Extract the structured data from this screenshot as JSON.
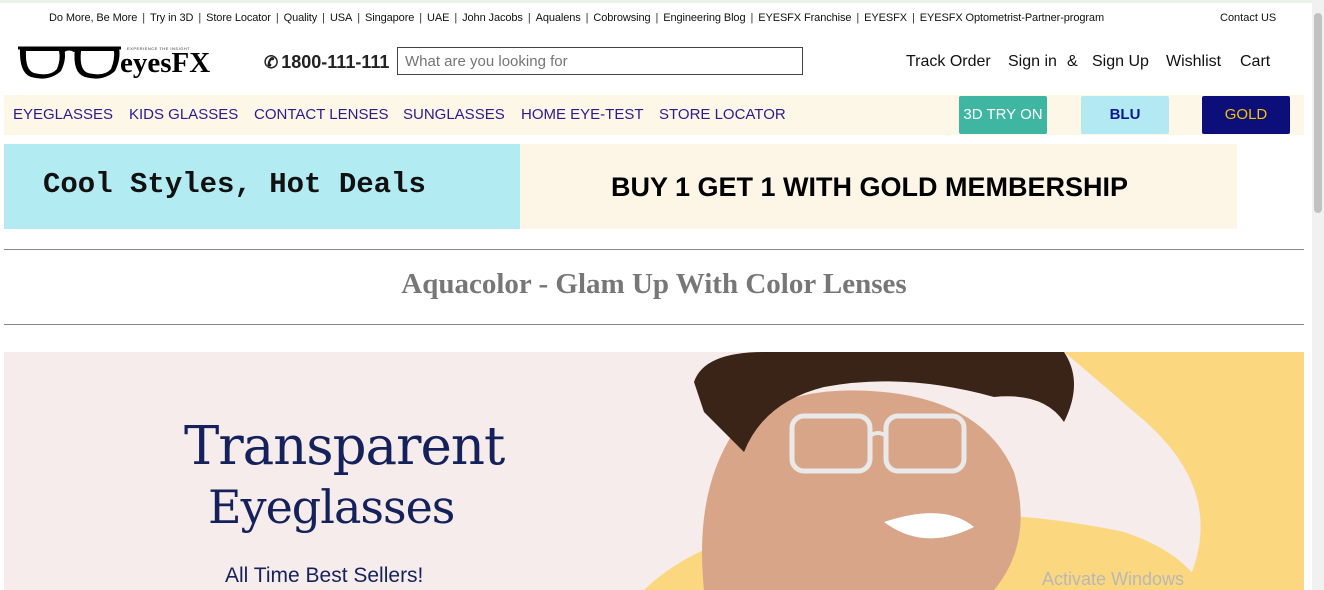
{
  "utility_links": [
    "Do More, Be More",
    "Try in 3D",
    "Store Locator",
    "Quality",
    "USA",
    "Singapore",
    "UAE",
    "John Jacobs",
    "Aqualens",
    "Cobrowsing",
    "Engineering Blog",
    "EYESFX Franchise",
    "EYESFX",
    "EYESFX Optometrist-Partner-program"
  ],
  "contact_label": "Contact US",
  "logo": {
    "text": "eyesFX",
    "tagline": "EXPERIENCE THE INSIGHT"
  },
  "phone": "1800-111-111",
  "search": {
    "placeholder": "What are you looking for"
  },
  "account": {
    "track_order": "Track Order",
    "sign_in": "Sign in",
    "amp": "&",
    "sign_up": "Sign Up",
    "wishlist": "Wishlist",
    "cart": "Cart"
  },
  "nav": [
    "EYEGLASSES",
    "KIDS GLASSES",
    "CONTACT LENSES",
    "SUNGLASSES",
    "HOME EYE-TEST",
    "STORE LOCATOR"
  ],
  "buttons": {
    "try_3d": "3D TRY ON",
    "blu": "BLU",
    "gold": "GOLD"
  },
  "promo": {
    "left": "Cool Styles, Hot Deals",
    "right": "BUY 1 GET 1 WITH GOLD MEMBERSHIP"
  },
  "section_heading": "Aquacolor - Glam Up With Color Lenses",
  "banner": {
    "title": "Transparent",
    "subtitle": "Eyeglasses",
    "tagline": "All Time Best Sellers!"
  },
  "watermark": "Activate Windows",
  "colors": {
    "nav_text": "#2e1a8e",
    "nav_bg": "#fdf7e7",
    "try3d_bg": "#3fb6a2",
    "blu_bg": "#b3e9f3",
    "gold_bg": "#0c0f7a",
    "gold_text": "#f3c400",
    "promo_left_bg": "#b3ebf2",
    "promo_right_bg": "#fdf6e7",
    "banner_bg": "#f6eceb",
    "banner_text": "#15215a",
    "banner_accent": "#fbd77f"
  }
}
